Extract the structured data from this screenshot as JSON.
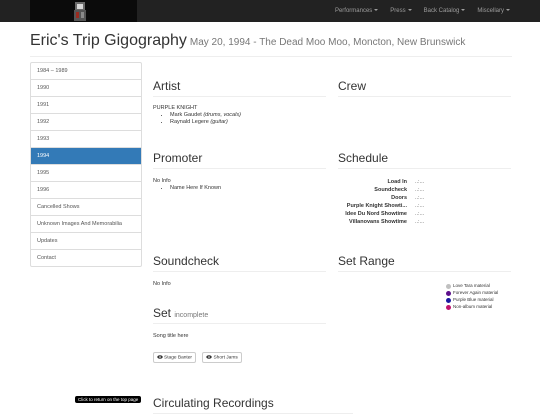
{
  "navbar": {
    "items": [
      {
        "label": "Performances"
      },
      {
        "label": "Press"
      },
      {
        "label": "Back Catalog"
      },
      {
        "label": "Miscellary"
      }
    ]
  },
  "header": {
    "title": "Eric's Trip Gigography",
    "subtitle": "May 20, 1994 - The Dead Moo Moo, Moncton, New Brunswick"
  },
  "sidebar": {
    "items": [
      {
        "label": "1984 – 1989"
      },
      {
        "label": "1990"
      },
      {
        "label": "1991"
      },
      {
        "label": "1992"
      },
      {
        "label": "1993"
      },
      {
        "label": "1994"
      },
      {
        "label": "1995"
      },
      {
        "label": "1996"
      },
      {
        "label": "Cancelled Shows"
      },
      {
        "label": "Unknown Images And Memorabilia"
      },
      {
        "label": "Updates"
      },
      {
        "label": "Contact"
      }
    ],
    "active_label": "1994"
  },
  "artist": {
    "heading": "Artist",
    "name": "PURPLE KNIGHT",
    "members": [
      {
        "name": "Mark Gaudet",
        "role": "(drums, vocals)"
      },
      {
        "name": "Raynald Legere",
        "role": "(guitar)"
      }
    ]
  },
  "crew": {
    "heading": "Crew"
  },
  "promoter": {
    "heading": "Promoter",
    "info": "No Info",
    "items": [
      "Name Here If Known"
    ]
  },
  "schedule": {
    "heading": "Schedule",
    "rows": [
      {
        "label": "Load In",
        "time": "..:..."
      },
      {
        "label": "Soundcheck",
        "time": "..:..."
      },
      {
        "label": "Doors",
        "time": "..:..."
      },
      {
        "label": "Purple Knight Showti...",
        "time": "..:..."
      },
      {
        "label": "Idee Du Nord Showtime",
        "time": "..:..."
      },
      {
        "label": "Villanovans Showtime",
        "time": "..:..."
      }
    ]
  },
  "soundcheck": {
    "heading": "Soundcheck",
    "info": "No Info"
  },
  "set_range": {
    "heading": "Set Range",
    "legend": [
      {
        "label": "Love Tara material",
        "color": "#c0c0c0"
      },
      {
        "label": "Forever Again material",
        "color": "#5c0f8b"
      },
      {
        "label": "Purple Blue material",
        "color": "#1a1aa0"
      },
      {
        "label": "Non-album material",
        "color": "#c0146e"
      }
    ]
  },
  "set": {
    "heading": "Set",
    "status": "incomplete",
    "song": "Song title here",
    "buttons": [
      {
        "label": "Stage Banter"
      },
      {
        "label": "Short Jams"
      }
    ]
  },
  "recordings": {
    "heading": "Circulating Recordings"
  },
  "to_top": {
    "label": "Click to return on the top page"
  },
  "colors": {
    "navbar": "#222222",
    "active": "#337ab7"
  }
}
